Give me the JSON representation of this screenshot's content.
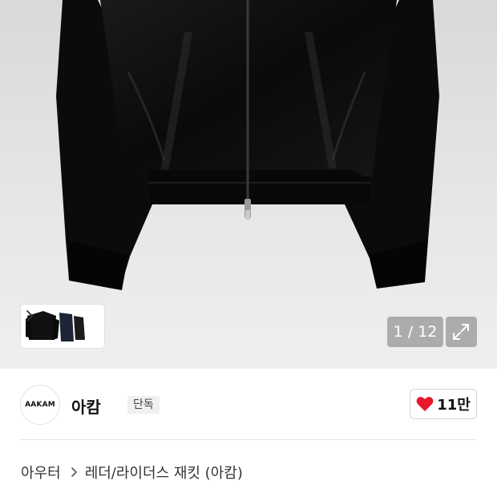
{
  "gallery": {
    "counter": "1 / 12",
    "thumbnail_count": 3
  },
  "brand": {
    "logo_text": "AAKAM",
    "name": "아캄",
    "badge": "단독"
  },
  "like": {
    "count": "11만",
    "icon": "heart-icon",
    "color": "#e8192c"
  },
  "breadcrumb": {
    "category": "아우터",
    "subcategory": "레더/라이더스 재킷 (아캄)"
  },
  "icons": {
    "thumb_next": "chevron-right-icon",
    "fullscreen": "expand-icon"
  }
}
